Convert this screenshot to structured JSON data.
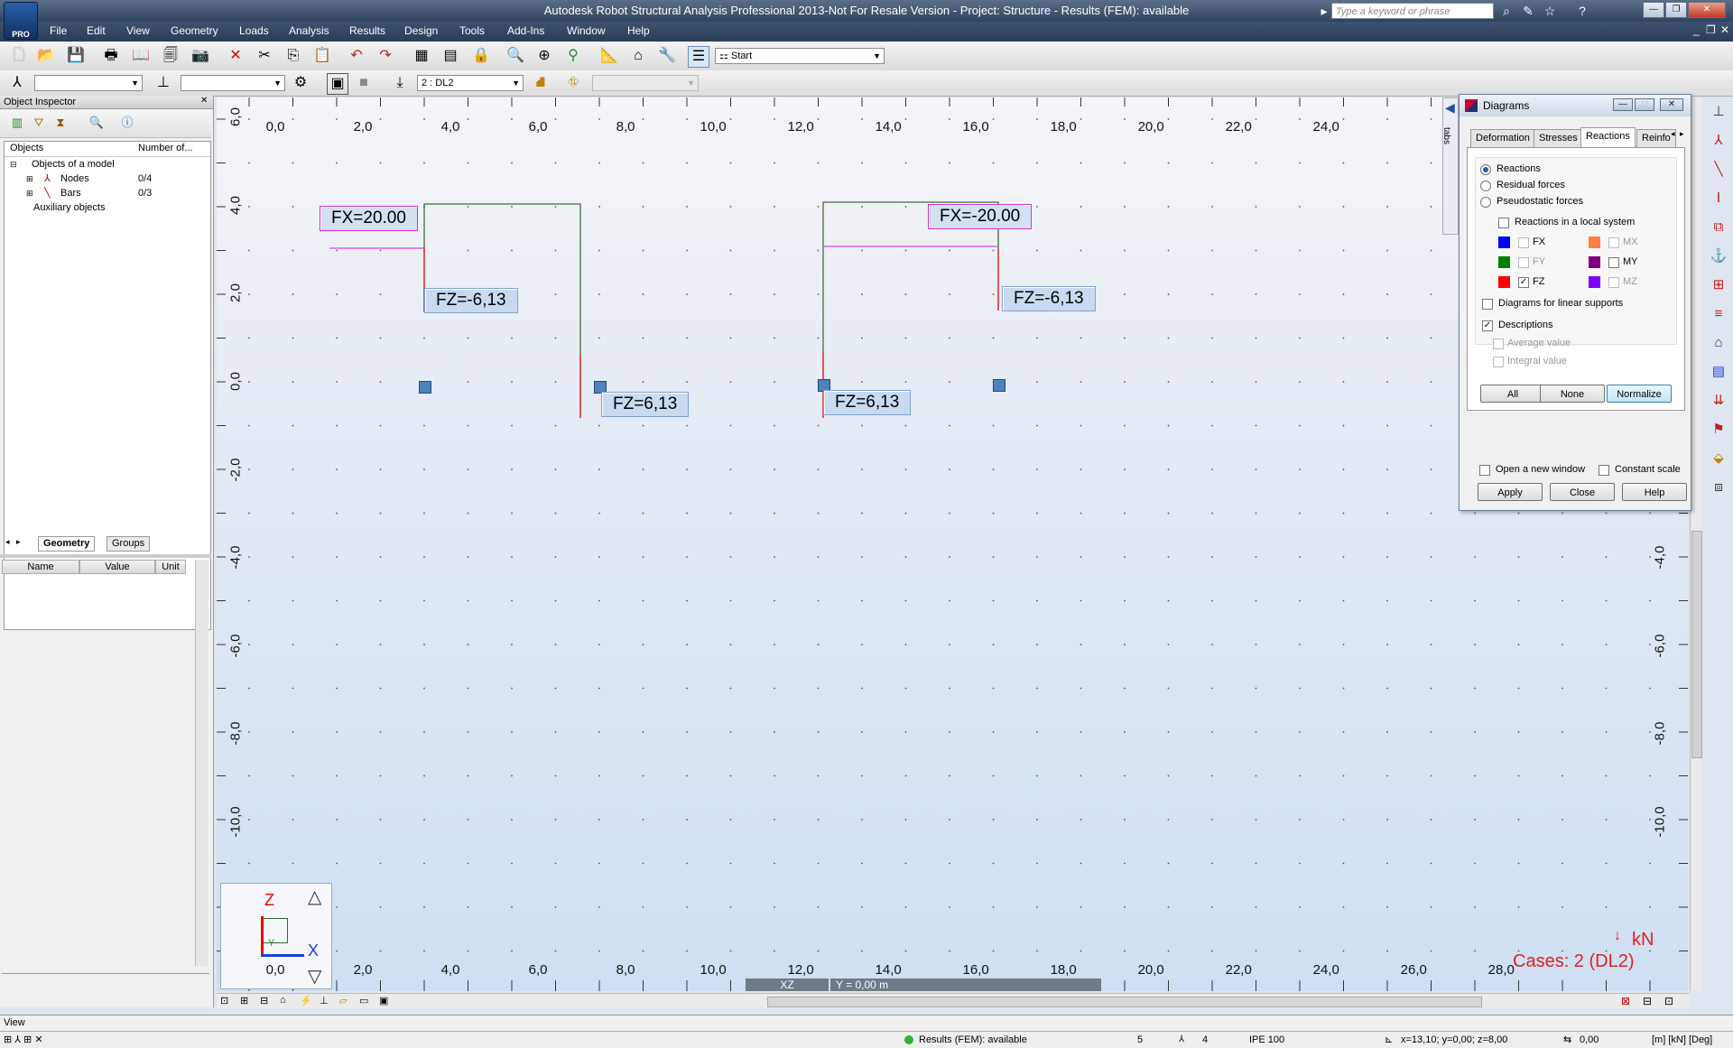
{
  "window": {
    "title": "Autodesk Robot Structural Analysis Professional 2013-Not For Resale Version - Project: Structure - Results (FEM): available",
    "logo_badge": "PRO",
    "search_placeholder": "Type a keyword or phrase",
    "help_label": "?",
    "minimize": "—",
    "restore": "❐",
    "close": "✕"
  },
  "menu": [
    "File",
    "Edit",
    "View",
    "Geometry",
    "Loads",
    "Analysis",
    "Results",
    "Design",
    "Tools",
    "Add-Ins",
    "Window",
    "Help"
  ],
  "toolbar": {
    "layout_select": "Start",
    "case_select": "2 : DL2"
  },
  "object_inspector": {
    "title": "Object Inspector",
    "columns": [
      "Objects",
      "Number of..."
    ],
    "tree": [
      {
        "label": "Objects of a model",
        "count": ""
      },
      {
        "label": "Nodes",
        "count": "0/4"
      },
      {
        "label": "Bars",
        "count": "0/3"
      },
      {
        "label": "Auxiliary objects",
        "count": ""
      }
    ],
    "tabs": [
      "Geometry",
      "Groups"
    ],
    "property_columns": [
      "Name",
      "Value",
      "Unit"
    ]
  },
  "viewport": {
    "x_ticks": [
      "0,0",
      "2,0",
      "4,0",
      "6,0",
      "8,0",
      "10,0",
      "12,0",
      "14,0",
      "16,0",
      "18,0",
      "20,0",
      "22,0",
      "24,0"
    ],
    "x_ticks_bottom": [
      "0,0",
      "2,0",
      "4,0",
      "6,0",
      "8,0",
      "10,0",
      "12,0",
      "14,0",
      "16,0",
      "18,0",
      "20,0",
      "22,0",
      "24,0",
      "26,0",
      "28,0"
    ],
    "y_ticks_left": [
      "6,0",
      "4,0",
      "2,0",
      "0,0",
      "-2,0",
      "-4,0",
      "-6,0",
      "-8,0",
      "-10,0"
    ],
    "y_ticks_right": [
      "-2,0",
      "-4,0",
      "-6,0",
      "-8,0",
      "-10,0"
    ],
    "labels": {
      "fx_left": "FX=20.00",
      "fx_right": "FX=-20.00",
      "fz_1": "FZ=-6,13",
      "fz_2": "FZ=6,13",
      "fz_3": "FZ=6,13",
      "fz_4": "FZ=-6,13"
    },
    "axis_z": "Z",
    "axis_x": "X",
    "axis_y": "Y",
    "unit": "kN",
    "cases": "Cases: 2 (DL2)",
    "view_plane": "XZ",
    "view_coord": "Y = 0,00 m"
  },
  "diagrams": {
    "title": "Diagrams",
    "tabs": [
      "Deformation",
      "Stresses",
      "Reactions",
      "Reinfo"
    ],
    "active_tab": "Reactions",
    "side_label": "tabs",
    "radios": [
      "Reactions",
      "Residual forces",
      "Pseudostatic forces"
    ],
    "local_system": "Reactions in a local system",
    "components": [
      {
        "name": "FX",
        "color": "#0000ff",
        "checked": false
      },
      {
        "name": "FY",
        "color": "#008000",
        "checked": false
      },
      {
        "name": "FZ",
        "color": "#ff0000",
        "checked": true
      },
      {
        "name": "MX",
        "color": "#ff8040",
        "checked": false
      },
      {
        "name": "MY",
        "color": "#800080",
        "checked": false
      },
      {
        "name": "MZ",
        "color": "#8000ff",
        "checked": false
      }
    ],
    "linear_supports": "Diagrams for linear supports",
    "descriptions": "Descriptions",
    "average": "Average value",
    "integral": "Integral value",
    "btn_all": "All",
    "btn_none": "None",
    "btn_normalize": "Normalize",
    "open_new_window": "Open a new window",
    "constant_scale": "Constant scale",
    "btn_apply": "Apply",
    "btn_close": "Close",
    "btn_help": "Help"
  },
  "status": {
    "view": "View",
    "results": "Results (FEM): available",
    "num1": "5",
    "num2": "4",
    "section": "IPE 100",
    "coords": "x=13,10; y=0,00; z=8,00",
    "angle": "0,00",
    "units": "[m] [kN] [Deg]"
  }
}
